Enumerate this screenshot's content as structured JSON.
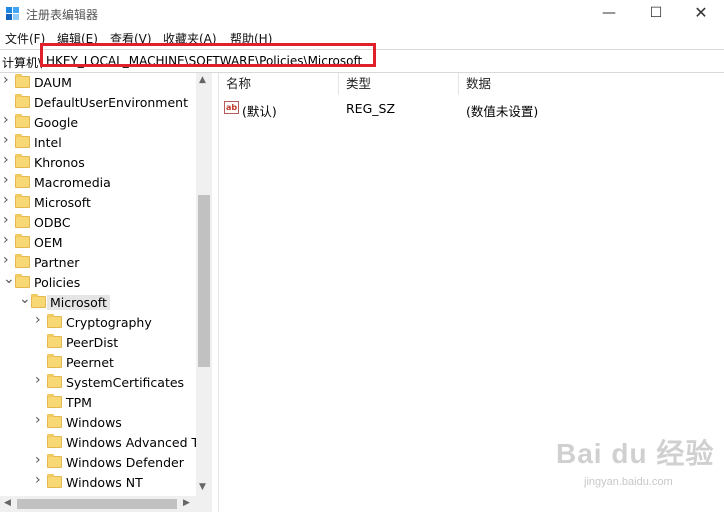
{
  "window": {
    "title": "注册表编辑器",
    "minimize_glyph": "—",
    "maximize_glyph": "☐",
    "close_glyph": "✕"
  },
  "menu": [
    {
      "label": "文件(F)"
    },
    {
      "label": "编辑(E)"
    },
    {
      "label": "查看(V)"
    },
    {
      "label": "收藏夹(A)"
    },
    {
      "label": "帮助(H)"
    }
  ],
  "address": {
    "prefix": "计算机\\",
    "path": "HKEY_LOCAL_MACHINE\\SOFTWARE\\Policies\\Microsoft"
  },
  "tree": [
    {
      "label": "DAUM",
      "level": 0,
      "expander": ">"
    },
    {
      "label": "DefaultUserEnvironment",
      "level": 0,
      "expander": ""
    },
    {
      "label": "Google",
      "level": 0,
      "expander": ">"
    },
    {
      "label": "Intel",
      "level": 0,
      "expander": ">"
    },
    {
      "label": "Khronos",
      "level": 0,
      "expander": ">"
    },
    {
      "label": "Macromedia",
      "level": 0,
      "expander": ">"
    },
    {
      "label": "Microsoft",
      "level": 0,
      "expander": ">"
    },
    {
      "label": "ODBC",
      "level": 0,
      "expander": ">"
    },
    {
      "label": "OEM",
      "level": 0,
      "expander": ">"
    },
    {
      "label": "Partner",
      "level": 0,
      "expander": ">"
    },
    {
      "label": "Policies",
      "level": 0,
      "expander": "v"
    },
    {
      "label": "Microsoft",
      "level": 1,
      "expander": "v",
      "selected": true
    },
    {
      "label": "Cryptography",
      "level": 2,
      "expander": ">"
    },
    {
      "label": "PeerDist",
      "level": 2,
      "expander": ""
    },
    {
      "label": "Peernet",
      "level": 2,
      "expander": ""
    },
    {
      "label": "SystemCertificates",
      "level": 2,
      "expander": ">"
    },
    {
      "label": "TPM",
      "level": 2,
      "expander": ""
    },
    {
      "label": "Windows",
      "level": 2,
      "expander": ">"
    },
    {
      "label": "Windows Advanced Th",
      "level": 2,
      "expander": ""
    },
    {
      "label": "Windows Defender",
      "level": 2,
      "expander": ">"
    },
    {
      "label": "Windows NT",
      "level": 2,
      "expander": ">"
    }
  ],
  "list": {
    "columns": [
      "名称",
      "类型",
      "数据"
    ],
    "rows": [
      {
        "name": "(默认)",
        "type": "REG_SZ",
        "data": "(数值未设置)",
        "icon": "string-value-icon"
      }
    ]
  },
  "watermark": {
    "logo": "Bai du 经验",
    "sub": "jingyan.baidu.com"
  },
  "colors": {
    "highlight_border": "#e0202a",
    "folder": "#f8d775",
    "selection": "#e5e5e5"
  }
}
